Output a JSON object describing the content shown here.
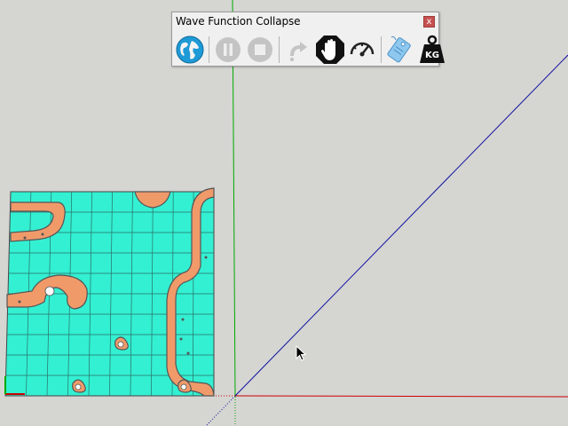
{
  "toolbar": {
    "title": "Wave Function Collapse",
    "close_label": "x",
    "buttons": [
      {
        "name": "globe-button",
        "icon": "globe-icon",
        "enabled": true
      },
      {
        "name": "pause-button",
        "icon": "pause-icon",
        "enabled": false
      },
      {
        "name": "stop-button",
        "icon": "stop-icon",
        "enabled": false
      },
      {
        "name": "redo-button",
        "icon": "redo-icon",
        "enabled": false
      },
      {
        "name": "stop-hand-button",
        "icon": "hand-stop-icon",
        "enabled": true
      },
      {
        "name": "speed-button",
        "icon": "speedometer-icon",
        "enabled": true
      },
      {
        "name": "tags-button",
        "icon": "tag-icon",
        "enabled": true
      },
      {
        "name": "weight-button",
        "icon": "weight-icon",
        "enabled": true,
        "label": "KG"
      }
    ]
  },
  "viewport": {
    "background": "#d5d5d2",
    "axes": {
      "red": "#cc0000",
      "green": "#00aa00",
      "blue": "#0000aa"
    },
    "tile_grid": {
      "rows": 10,
      "cols": 10,
      "fill": "#33f0d2",
      "path_color": "#f09a6a"
    }
  }
}
